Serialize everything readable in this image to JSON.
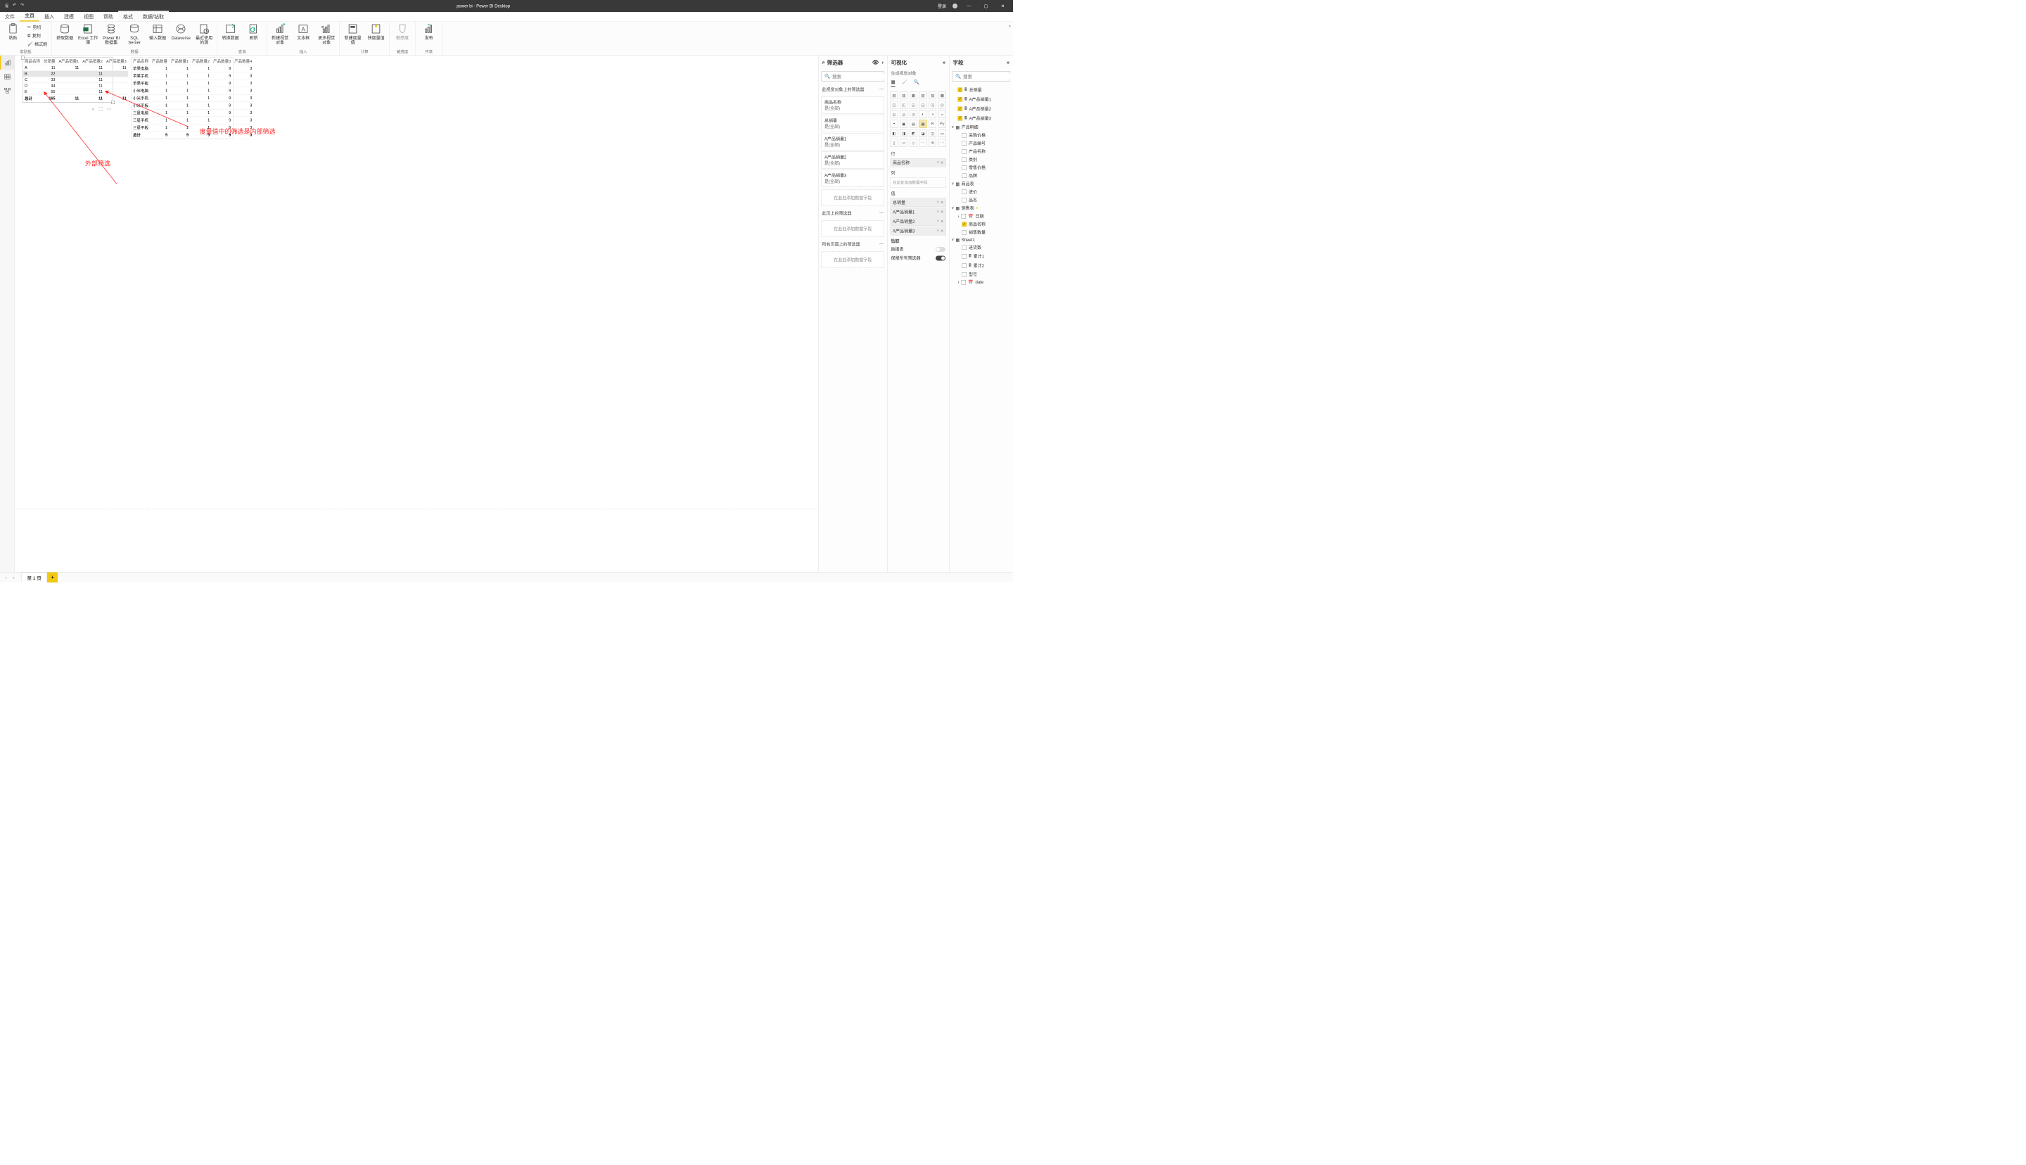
{
  "title": "power bi - Power BI Desktop",
  "login": "登录",
  "menu": [
    "文件",
    "主页",
    "插入",
    "建模",
    "视图",
    "帮助",
    "格式",
    "数据/钻取"
  ],
  "menu_active": 1,
  "ribbon": {
    "clipboard": {
      "paste": "粘贴",
      "cut": "剪切",
      "copy": "复制",
      "format": "格式刷",
      "name": "剪贴板"
    },
    "data": {
      "get": "获取数据",
      "excel": "Excel 工作簿",
      "pbi": "Power BI 数据集",
      "sql": "SQL Server",
      "input": "输入数据",
      "dv": "Dataverse",
      "recent": "最近使用的源",
      "name": "数据"
    },
    "query": {
      "transform": "转换数据",
      "refresh": "刷新",
      "name": "查询"
    },
    "insert": {
      "newvis": "新建视觉对象",
      "textbox": "文本框",
      "morevis": "更多视觉对象",
      "name": "插入"
    },
    "calc": {
      "newmeasure": "新建度量值",
      "quickmeasure": "快度量值",
      "name": "计算"
    },
    "sens": {
      "label": "敏感度",
      "name": "敏感度"
    },
    "share": {
      "publish": "发布",
      "name": "共享"
    }
  },
  "table1": {
    "headers": [
      "商品名称",
      "总销量",
      "A产品销量1",
      "A产品销量2",
      "A产品销量3"
    ],
    "rows": [
      [
        "A",
        "11",
        "11",
        "11",
        "11"
      ],
      [
        "B",
        "22",
        "",
        "11",
        ""
      ],
      [
        "C",
        "33",
        "",
        "11",
        ""
      ],
      [
        "D",
        "44",
        "",
        "11",
        ""
      ],
      [
        "E",
        "55",
        "",
        "11",
        ""
      ]
    ],
    "total": [
      "总计",
      "165",
      "11",
      "11",
      "11"
    ]
  },
  "table2": {
    "headers": [
      "产品名称",
      "产品数量",
      "产品数量1",
      "产品数量2",
      "产品数量3",
      "产品数量4"
    ],
    "rows": [
      [
        "苹果电脑",
        "1",
        "1",
        "1",
        "9",
        "3"
      ],
      [
        "苹果手机",
        "1",
        "1",
        "1",
        "9",
        "3"
      ],
      [
        "苹果平板",
        "1",
        "1",
        "1",
        "9",
        "3"
      ],
      [
        "小米电脑",
        "1",
        "1",
        "1",
        "9",
        "3"
      ],
      [
        "小米手机",
        "1",
        "1",
        "1",
        "9",
        "3"
      ],
      [
        "小米平板",
        "1",
        "1",
        "1",
        "9",
        "3"
      ],
      [
        "三星电脑",
        "1",
        "1",
        "1",
        "9",
        "3"
      ],
      [
        "三星手机",
        "1",
        "1",
        "1",
        "9",
        "3"
      ],
      [
        "三星平板",
        "1",
        "1",
        "1",
        "9",
        "3"
      ]
    ],
    "total": [
      "总计",
      "9",
      "9",
      "9",
      "9",
      "3"
    ]
  },
  "annot": {
    "a1": "度量值中的筛选是内部筛选",
    "a2": "外部筛选"
  },
  "filters": {
    "title": "筛选器",
    "search": "搜索",
    "onvisual": "此视觉对象上的筛选器",
    "cards": [
      {
        "name": "商品名称",
        "val": "是(全部)"
      },
      {
        "name": "总销量",
        "val": "是(全部)"
      },
      {
        "name": "A产品销量1",
        "val": "是(全部)"
      },
      {
        "name": "A产品销量2",
        "val": "是(全部)"
      },
      {
        "name": "A产品销量3",
        "val": "是(全部)"
      }
    ],
    "addfield": "在此处添加数据字段",
    "onpage": "此页上的筛选器",
    "onall": "所有页面上的筛选器"
  },
  "viz": {
    "title": "可视化",
    "sub": "生成视觉对象",
    "rows": "行",
    "cols": "列",
    "values": "值",
    "row_items": [
      "商品名称"
    ],
    "val_items": [
      "总销量",
      "A产品销量1",
      "A产品销量2",
      "A产品销量3"
    ],
    "addfield": "在此处添加数据字段",
    "drill": "钻取",
    "cross": "跨报表",
    "keepall": "保留所有筛选器"
  },
  "fields": {
    "title": "字段",
    "search": "搜索",
    "top": [
      {
        "label": "总销量",
        "checked": true,
        "icon": "calc"
      },
      {
        "label": "A产品销量1",
        "checked": true,
        "icon": "calc"
      },
      {
        "label": "A产品销量2",
        "checked": true,
        "icon": "calc"
      },
      {
        "label": "A产品销量3",
        "checked": true,
        "icon": "calc"
      }
    ],
    "tables": [
      {
        "name": "产品明细",
        "open": true,
        "cols": [
          {
            "label": "采购价格"
          },
          {
            "label": "产品编号"
          },
          {
            "label": "产品名称"
          },
          {
            "label": "类别"
          },
          {
            "label": "零售价格"
          },
          {
            "label": "品牌"
          }
        ]
      },
      {
        "name": "商品表",
        "open": true,
        "cols": [
          {
            "label": "进价"
          },
          {
            "label": "品名"
          }
        ]
      },
      {
        "name": "销售表",
        "open": true,
        "badge": true,
        "cols": [
          {
            "label": "日期",
            "hier": true,
            "caret": true
          },
          {
            "label": "商品名称",
            "checked": true
          },
          {
            "label": "销售数量"
          }
        ]
      },
      {
        "name": "Sheet1",
        "open": true,
        "cols": [
          {
            "label": "进货数"
          },
          {
            "label": "累计1",
            "icon": "calc"
          },
          {
            "label": "累计2",
            "icon": "calc"
          },
          {
            "label": "型号"
          },
          {
            "label": "date",
            "hier": true,
            "caret": true
          }
        ]
      }
    ]
  },
  "page": {
    "name": "第 1 页"
  }
}
